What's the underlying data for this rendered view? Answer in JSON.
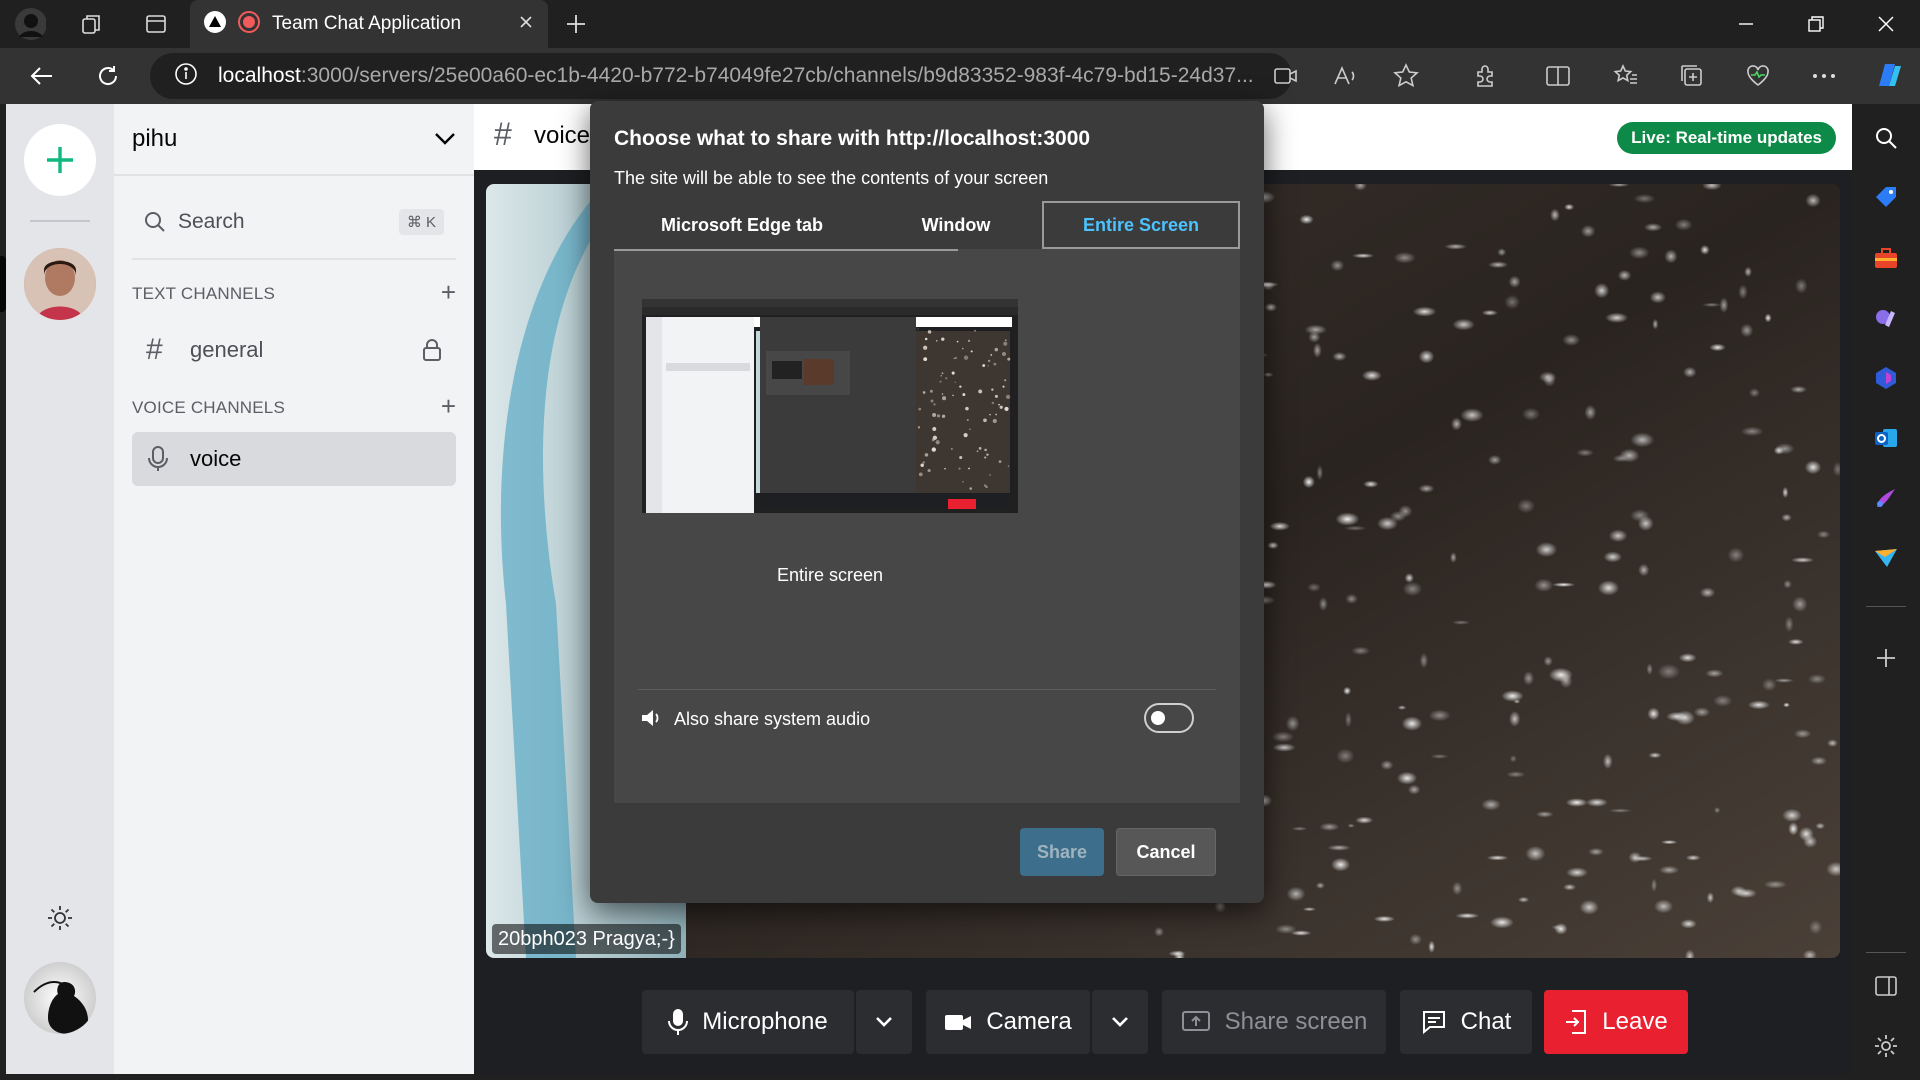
{
  "browser": {
    "tab_title": "Team Chat Application",
    "url_host": "localhost",
    "url_rest": ":3000/servers/25e00a60-ec1b-4420-b772-b74049fe27cb/channels/b9d83352-983f-4c79-bd15-24d37..."
  },
  "server": {
    "name": "pihu",
    "search_label": "Search",
    "search_shortcut": "⌘ K",
    "text_section": "TEXT CHANNELS",
    "voice_section": "VOICE CHANNELS",
    "text_channels": [
      {
        "label": "general"
      }
    ],
    "voice_channels": [
      {
        "label": "voice"
      }
    ]
  },
  "main": {
    "channel_name": "voice",
    "live_badge": "Live: Real-time updates",
    "participant_label": "20bph023 Pragya;-}",
    "colors": {
      "live_badge": "#0d8a48",
      "leave": "#e8202f",
      "accent": "#4cc2ff"
    }
  },
  "dialog": {
    "title": "Choose what to share with http://localhost:3000",
    "subtitle": "The site will be able to see the contents of your screen",
    "tabs": [
      "Microsoft Edge tab",
      "Window",
      "Entire Screen"
    ],
    "selected_tab": "Entire Screen",
    "thumbnail_label": "Entire screen",
    "audio_label": "Also share system audio",
    "audio_enabled": false,
    "share_label": "Share",
    "cancel_label": "Cancel"
  },
  "controls": {
    "microphone": "Microphone",
    "camera": "Camera",
    "share_screen": "Share screen",
    "chat": "Chat",
    "leave": "Leave"
  }
}
